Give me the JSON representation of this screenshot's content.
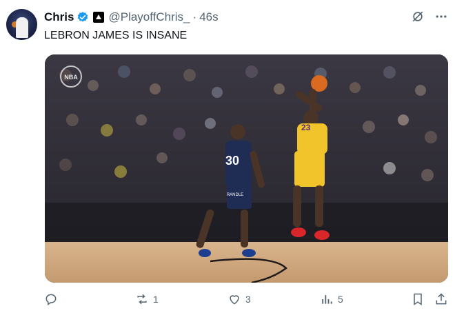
{
  "author": {
    "name": "Chris",
    "handle": "@PlayoffChris_",
    "time": "46s"
  },
  "tweet": {
    "text": "LEBRON JAMES IS INSANE"
  },
  "media": {
    "jersey_left_number": "30",
    "jersey_left_name": "RANDLE",
    "jersey_right_number": "23",
    "watermark": "NBA"
  },
  "actions": {
    "replies": "",
    "reposts": "1",
    "likes": "3",
    "views": "5"
  },
  "icons": [
    "verified-badge-icon",
    "affiliate-icon",
    "grok-icon",
    "more-icon",
    "reply-icon",
    "repost-icon",
    "like-icon",
    "views-icon",
    "bookmark-icon",
    "share-icon"
  ],
  "colors": {
    "accent": "#1d9bf0",
    "muted": "#536471",
    "text": "#0f1419"
  }
}
